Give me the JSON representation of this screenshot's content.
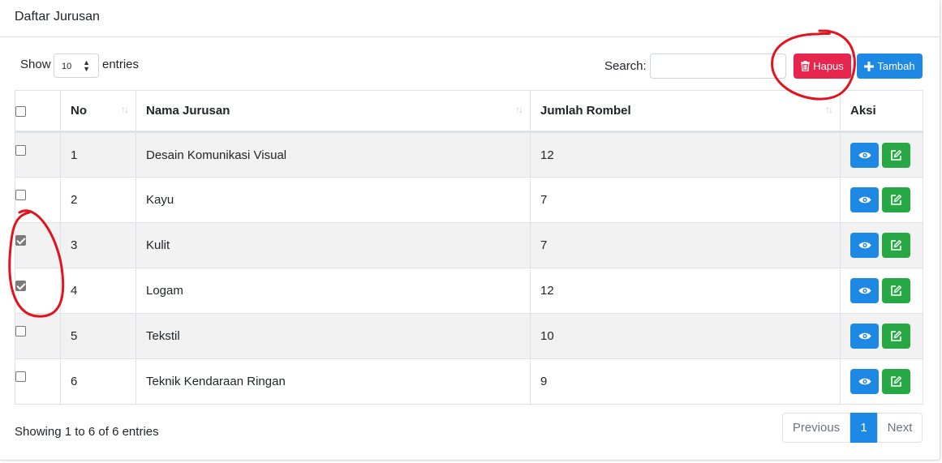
{
  "card": {
    "title": "Daftar Jurusan"
  },
  "length": {
    "before": "Show",
    "value": "10",
    "after": "entries"
  },
  "search": {
    "label": "Search:",
    "value": ""
  },
  "buttons": {
    "hapus": "Hapus",
    "tambah": "Tambah"
  },
  "table": {
    "headers": {
      "no": "No",
      "nama": "Nama Jurusan",
      "jumlah": "Jumlah Rombel",
      "aksi": "Aksi"
    },
    "rows": [
      {
        "no": "1",
        "nama": "Desain Komunikasi Visual",
        "jumlah": "12",
        "checked": false
      },
      {
        "no": "2",
        "nama": "Kayu",
        "jumlah": "7",
        "checked": false
      },
      {
        "no": "3",
        "nama": "Kulit",
        "jumlah": "7",
        "checked": true
      },
      {
        "no": "4",
        "nama": "Logam",
        "jumlah": "12",
        "checked": true
      },
      {
        "no": "5",
        "nama": "Tekstil",
        "jumlah": "10",
        "checked": false
      },
      {
        "no": "6",
        "nama": "Teknik Kendaraan Ringan",
        "jumlah": "9",
        "checked": false
      }
    ]
  },
  "footer": {
    "info": "Showing 1 to 6 of 6 entries",
    "previous": "Previous",
    "page": "1",
    "next": "Next"
  },
  "icons": {
    "hapus": "trash-icon",
    "tambah": "plus-icon",
    "view": "eye-icon",
    "edit": "edit-icon"
  },
  "colors": {
    "danger": "#e8254c",
    "primary": "#1e88e5",
    "success": "#28a745",
    "annotation": "#e0141e"
  }
}
